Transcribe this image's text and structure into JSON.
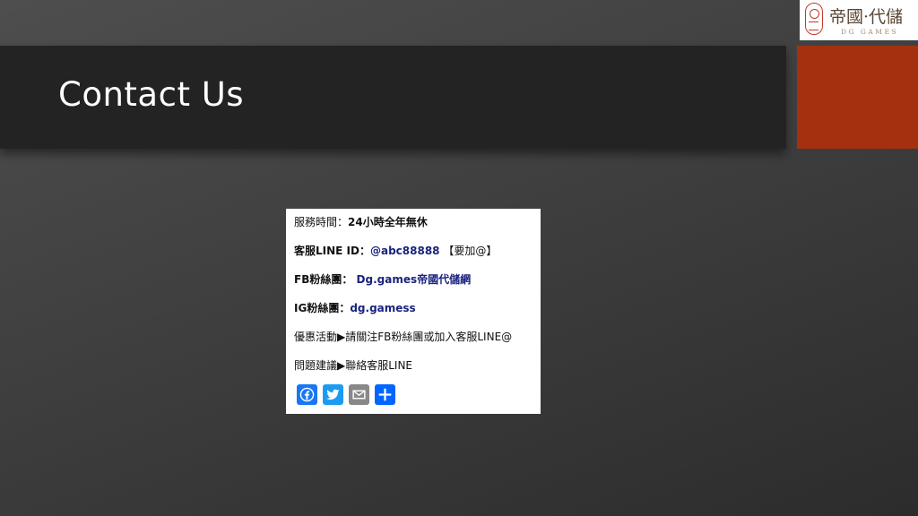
{
  "slide": {
    "title": "Contact Us"
  },
  "logo": {
    "name": "帝國·代儲",
    "sub": "DG GAMES"
  },
  "contact": {
    "line1": {
      "label": "服務時間：",
      "value": "24小時全年無休"
    },
    "line2": {
      "label": "客服LINE ID：",
      "value": "@abc88888",
      "note": " 【要加@】"
    },
    "line3": {
      "label": "FB粉絲團： ",
      "value": "Dg.games帝國代儲網"
    },
    "line4": {
      "label": "IG粉絲團：",
      "value": "dg.gamess"
    },
    "line5": {
      "label": "優惠活動▶請關注FB粉絲團或加入客服LINE@"
    },
    "line6": {
      "label": "問題建議▶聯絡客服LINE"
    }
  },
  "share": {
    "icons": [
      "facebook-icon",
      "twitter-icon",
      "email-icon",
      "share-icon"
    ]
  },
  "colors": {
    "accent": "#a5300f",
    "title_bar": "#232323",
    "link": "#1a237e",
    "facebook": "#1877f2",
    "twitter": "#1d9bf0",
    "email": "#888888",
    "share": "#0166ff"
  }
}
